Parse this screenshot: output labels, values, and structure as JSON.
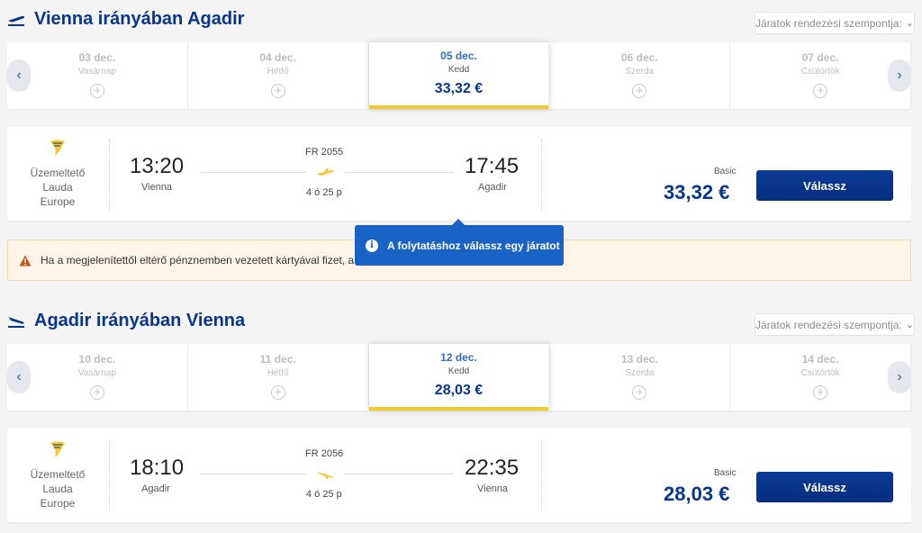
{
  "outbound": {
    "title": "Vienna irányában Agadir",
    "sort_label": "Járatok rendezési szempontja:",
    "dates": [
      {
        "date": "03 dec.",
        "weekday": "Vasárnap",
        "price": null
      },
      {
        "date": "04 dec.",
        "weekday": "Hétfő",
        "price": null
      },
      {
        "date": "05 dec.",
        "weekday": "Kedd",
        "price": "33,32 €"
      },
      {
        "date": "06 dec.",
        "weekday": "Szerda",
        "price": null
      },
      {
        "date": "07 dec.",
        "weekday": "Csütörtök",
        "price": null
      }
    ],
    "selected_index": 2,
    "flight": {
      "operator": [
        "Üzemeltető",
        "Lauda",
        "Europe"
      ],
      "dep_time": "13:20",
      "dep_city": "Vienna",
      "flight_no": "FR 2055",
      "duration": "4 ó 25 p",
      "arr_time": "17:45",
      "arr_city": "Agadir",
      "fare_label": "Basic",
      "price": "33,32 €",
      "button": "Válassz"
    }
  },
  "warning_text": "Ha a megjelenítettől eltérő pénznemben vezetett kártyával fizet, a",
  "tooltip_text": "A folytatáshoz válassz egy járatot",
  "inbound": {
    "title": "Agadir irányában Vienna",
    "sort_label": "Járatok rendezési szempontja:",
    "dates": [
      {
        "date": "10 dec.",
        "weekday": "Vasárnap",
        "price": null
      },
      {
        "date": "11 dec.",
        "weekday": "Hétfő",
        "price": null
      },
      {
        "date": "12 dec.",
        "weekday": "Kedd",
        "price": "28,03 €"
      },
      {
        "date": "13 dec.",
        "weekday": "Szerda",
        "price": null
      },
      {
        "date": "14 dec.",
        "weekday": "Csütörtök",
        "price": null
      }
    ],
    "selected_index": 2,
    "flight": {
      "operator": [
        "Üzemeltető",
        "Lauda",
        "Europe"
      ],
      "dep_time": "18:10",
      "dep_city": "Agadir",
      "flight_no": "FR 2056",
      "duration": "4 ó 25 p",
      "arr_time": "22:35",
      "arr_city": "Vienna",
      "fare_label": "Basic",
      "price": "28,03 €",
      "button": "Válassz"
    }
  },
  "colors": {
    "brand": "#073590",
    "accent_yellow": "#f1c931",
    "tooltip": "#1a63c6"
  },
  "icons": {
    "departure": "plane-takeoff-icon",
    "arrival": "plane-landing-icon",
    "no_flight": "no-flight-icon",
    "warning": "warning-triangle-icon",
    "info": "info-icon",
    "operator": "ryanair-harp-logo"
  }
}
